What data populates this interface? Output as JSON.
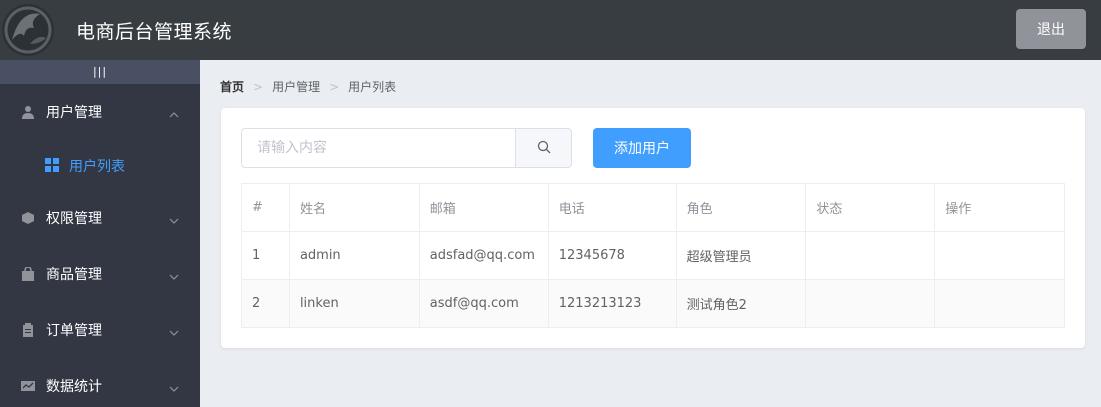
{
  "header": {
    "title": "电商后台管理系统",
    "logout_label": "退出",
    "logo_icon": "dragon-logo-icon"
  },
  "sidebar": {
    "toggle_label": "|||",
    "items": [
      {
        "label": "用户管理",
        "icon": "user-icon",
        "expanded": true,
        "children": [
          {
            "label": "用户列表",
            "icon": "grid-icon",
            "active": true
          }
        ]
      },
      {
        "label": "权限管理",
        "icon": "cube-icon",
        "expanded": false
      },
      {
        "label": "商品管理",
        "icon": "bag-icon",
        "expanded": false
      },
      {
        "label": "订单管理",
        "icon": "clipboard-icon",
        "expanded": false
      },
      {
        "label": "数据统计",
        "icon": "chart-icon",
        "expanded": false
      }
    ],
    "colors": {
      "bg": "#333744",
      "active": "#409eff"
    }
  },
  "breadcrumb": {
    "items": [
      "首页",
      "用户管理",
      "用户列表"
    ]
  },
  "search": {
    "placeholder": "请输入内容",
    "value": ""
  },
  "toolbar": {
    "add_label": "添加用户"
  },
  "table": {
    "columns": [
      "#",
      "姓名",
      "邮箱",
      "电话",
      "角色",
      "状态",
      "操作"
    ],
    "rows": [
      [
        "1",
        "admin",
        "adsfad@qq.com",
        "12345678",
        "超级管理员",
        "",
        ""
      ],
      [
        "2",
        "linken",
        "asdf@qq.com",
        "1213213123",
        "测试角色2",
        "",
        ""
      ]
    ]
  },
  "colors": {
    "primary": "#409eff",
    "header": "#373d41"
  }
}
